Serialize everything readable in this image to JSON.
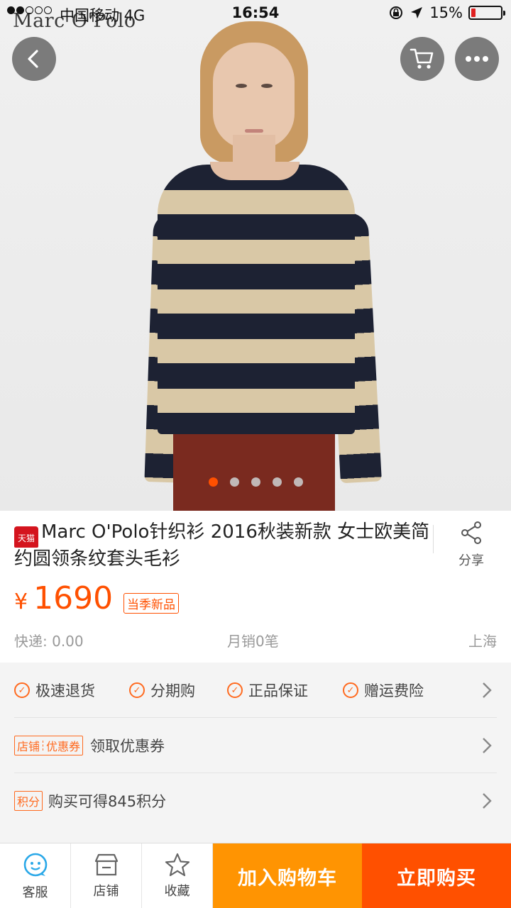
{
  "status_bar": {
    "carrier": "中国移动  4G",
    "time": "16:54",
    "battery": "15%",
    "battery_level": 0.15
  },
  "hero": {
    "brand": "Marc O'Polo",
    "image_count": 5,
    "active_index": 0
  },
  "product": {
    "store_badge": "天猫",
    "title": "Marc O'Polo针织衫 2016秋装新款 女士欧美简约圆领条纹套头毛衫",
    "share_label": "分享",
    "price_symbol": "¥",
    "price": "1690",
    "season_badge": "当季新品",
    "shipping": "快递: 0.00",
    "monthly_sales": "月销0笔",
    "location": "上海"
  },
  "services": {
    "items": [
      "极速退货",
      "分期购",
      "正品保证",
      "赠运费险"
    ],
    "coupon_tag_left": "店铺",
    "coupon_tag_right": "优惠券",
    "coupon_text": "领取优惠券",
    "points_tag": "积分",
    "points_text": "购买可得845积分"
  },
  "bottom_bar": {
    "tabs": [
      "客服",
      "店铺",
      "收藏"
    ],
    "add_to_cart": "加入购物车",
    "buy_now": "立即购买"
  },
  "colors": {
    "accent": "#ff5000",
    "cart_button": "#ff9402",
    "icon_blue": "#2aa8e8"
  }
}
